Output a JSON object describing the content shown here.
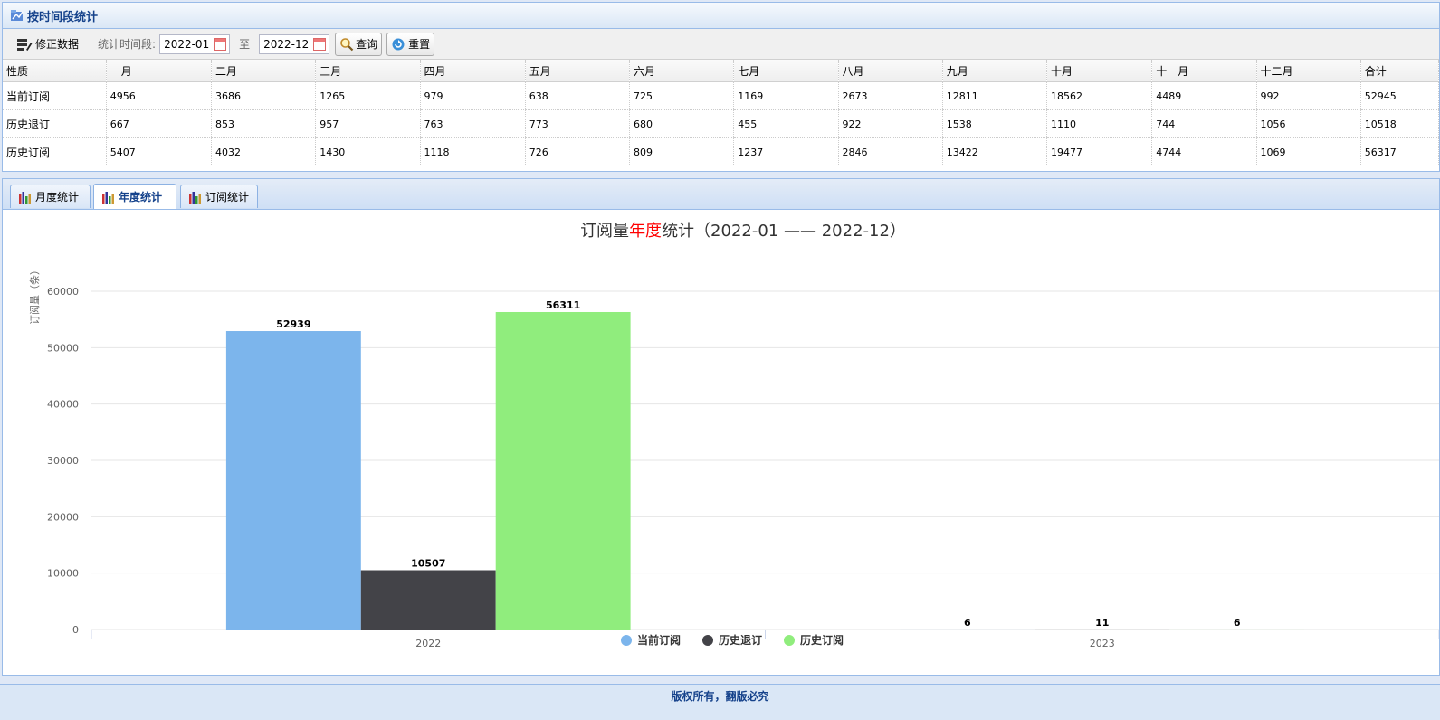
{
  "panel": {
    "title": "按时间段统计"
  },
  "toolbar": {
    "fix_label": "修正数据",
    "range_label": "统计时间段:",
    "start_value": "2022-01",
    "to_label": "至",
    "end_value": "2022-12",
    "query_label": "查询",
    "reset_label": "重置"
  },
  "table": {
    "headers": [
      "性质",
      "一月",
      "二月",
      "三月",
      "四月",
      "五月",
      "六月",
      "七月",
      "八月",
      "九月",
      "十月",
      "十一月",
      "十二月",
      "合计"
    ],
    "rows": [
      [
        "当前订阅",
        "4956",
        "3686",
        "1265",
        "979",
        "638",
        "725",
        "1169",
        "2673",
        "12811",
        "18562",
        "4489",
        "992",
        "52945"
      ],
      [
        "历史退订",
        "667",
        "853",
        "957",
        "763",
        "773",
        "680",
        "455",
        "922",
        "1538",
        "1110",
        "744",
        "1056",
        "10518"
      ],
      [
        "历史订阅",
        "5407",
        "4032",
        "1430",
        "1118",
        "726",
        "809",
        "1237",
        "2846",
        "13422",
        "19477",
        "4744",
        "1069",
        "56317"
      ]
    ]
  },
  "tabs": [
    {
      "label": "月度统计",
      "active": false
    },
    {
      "label": "年度统计",
      "active": true
    },
    {
      "label": "订阅统计",
      "active": false
    }
  ],
  "chart_data": {
    "type": "bar",
    "title_parts": [
      "订阅量",
      "年度",
      "统计（2022-01 —— 2022-12）"
    ],
    "title_highlight_color": "#ff0000",
    "ylabel": "订阅量（条）",
    "xlabel": "",
    "ylim": [
      0,
      60000
    ],
    "yticks": [
      0,
      10000,
      20000,
      30000,
      40000,
      50000,
      60000
    ],
    "categories": [
      "2022",
      "2023"
    ],
    "series": [
      {
        "name": "当前订阅",
        "color": "#7cb5ec",
        "values": [
          52939,
          6
        ]
      },
      {
        "name": "历史退订",
        "color": "#434348",
        "values": [
          10507,
          11
        ]
      },
      {
        "name": "历史订阅",
        "color": "#90ed7d",
        "values": [
          56311,
          6
        ]
      }
    ],
    "grid": true,
    "legend": "bottom-center"
  },
  "footer": {
    "text": "版权所有，翻版必究"
  }
}
